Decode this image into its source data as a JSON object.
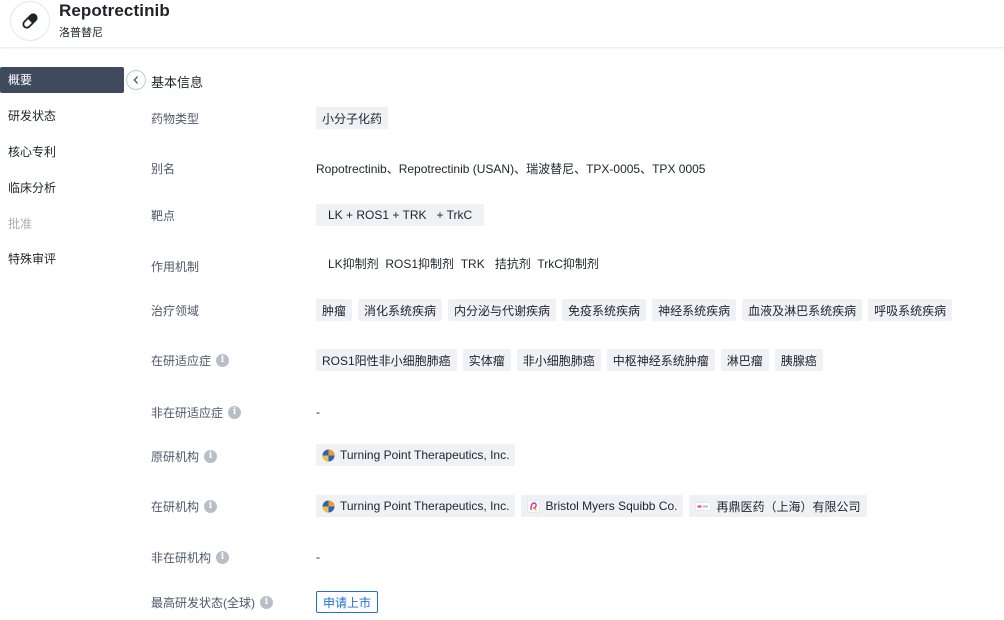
{
  "header": {
    "drug_name": "Repotrectinib",
    "drug_name_cn": "洛普替尼",
    "logo_icon": "capsule-icon"
  },
  "sidebar": {
    "items": [
      {
        "label": "概要",
        "state": "active"
      },
      {
        "label": "研发状态",
        "state": "normal"
      },
      {
        "label": "核心专利",
        "state": "normal"
      },
      {
        "label": "临床分析",
        "state": "normal"
      },
      {
        "label": "批准",
        "state": "disabled"
      },
      {
        "label": "特殊审评",
        "state": "normal"
      }
    ],
    "collapse_icon": "chevron-left-icon"
  },
  "section": {
    "title": "基本信息"
  },
  "info_icon_glyph": "i",
  "rows": {
    "drug_type": {
      "label": "药物类型",
      "tags": [
        "小分子化药"
      ]
    },
    "alias": {
      "label": "别名",
      "value": "Ropotrectinib、Repotrectinib (USAN)、瑞波替尼、TPX-0005、TPX 0005"
    },
    "target": {
      "label": "靶点",
      "value": "LK + ROS1 + TRK   + TrkC"
    },
    "mechanism": {
      "label": "作用机制",
      "value": "LK抑制剂  ROS1抑制剂  TRK   拮抗剂  TrkC抑制剂"
    },
    "therapeutic_area": {
      "label": "治疗领域",
      "tags": [
        "肿瘤",
        "消化系统疾病",
        "内分泌与代谢疾病",
        "免疫系统疾病",
        "神经系统疾病",
        "血液及淋巴系统疾病",
        "呼吸系统疾病"
      ]
    },
    "active_indication": {
      "label": "在研适应症",
      "tags": [
        "ROS1阳性非小细胞肺癌",
        "实体瘤",
        "非小细胞肺癌",
        "中枢神经系统肿瘤",
        "淋巴瘤",
        "胰腺癌"
      ]
    },
    "inactive_indication": {
      "label": "非在研适应症",
      "value": "-"
    },
    "originator": {
      "label": "原研机构",
      "orgs": [
        {
          "name": "Turning Point Therapeutics, Inc.",
          "logo": "turning-point-logo"
        }
      ]
    },
    "active_org": {
      "label": "在研机构",
      "orgs": [
        {
          "name": "Turning Point Therapeutics, Inc.",
          "logo": "turning-point-logo"
        },
        {
          "name": "Bristol Myers Squibb Co.",
          "logo": "bms-logo"
        },
        {
          "name": "再鼎医药（上海）有限公司",
          "logo": "zai-lab-logo"
        }
      ]
    },
    "inactive_org": {
      "label": "非在研机构",
      "value": "-"
    },
    "highest_status": {
      "label": "最高研发状态(全球)",
      "value": "申请上市"
    }
  },
  "colors": {
    "nav_active_bg": "#3f4a5c",
    "status_blue": "#1f6fd8",
    "tag_bg": "#f0f1f4"
  }
}
